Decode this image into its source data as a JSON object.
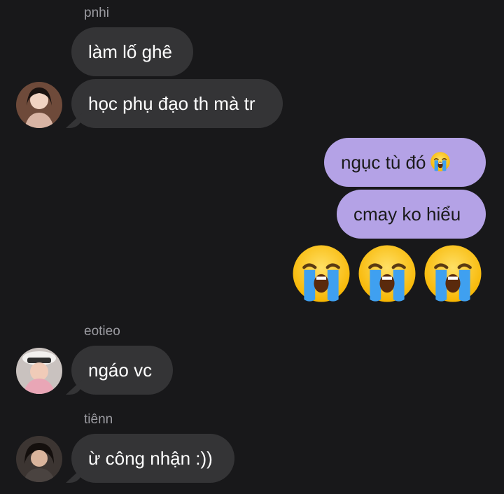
{
  "messages": [
    {
      "sender": "pnhi",
      "text": "làm lố ghê"
    },
    {
      "text": "học phụ đạo th mà tr"
    },
    {
      "text": "ngục tù đó",
      "emoji": "loudly-crying-face"
    },
    {
      "text": "cmay ko hiểu"
    },
    {
      "emoji_only": [
        "loudly-crying-face",
        "loudly-crying-face",
        "loudly-crying-face"
      ]
    },
    {
      "sender": "eotieo",
      "text": "ngáo vc"
    },
    {
      "sender": "tiênn",
      "text": "ừ công nhận :))"
    }
  ],
  "colors": {
    "background": "#18181a",
    "incoming_bubble": "#343436",
    "outgoing_bubble": "#b4a2e6",
    "sender_name": "#9c9ca2"
  }
}
